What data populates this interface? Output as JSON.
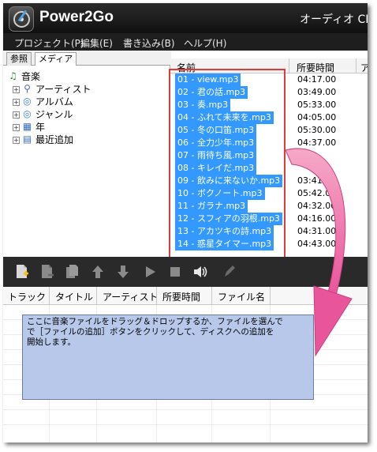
{
  "window": {
    "app_title": "Power2Go",
    "mode_label": "オーディオ CD"
  },
  "menu": [
    "プロジェクト(P)",
    "編集(E)",
    "書き込み(B)",
    "ヘルプ(H)"
  ],
  "tabs": [
    "参照",
    "メディア"
  ],
  "tree": [
    {
      "label": "音楽",
      "icon": "music-note-icon"
    },
    {
      "label": "アーティスト",
      "icon": "person-icon"
    },
    {
      "label": "アルバム",
      "icon": "disc-icon"
    },
    {
      "label": "ジャンル",
      "icon": "disc-icon"
    },
    {
      "label": "年",
      "icon": "calendar-icon"
    },
    {
      "label": "最近追加",
      "icon": "calendar-icon"
    }
  ],
  "file_list": {
    "columns": [
      "名前",
      "所要時間",
      "ア"
    ],
    "rows": [
      {
        "name": "01 - view.mp3",
        "duration": "04:17.00"
      },
      {
        "name": "02 - 君の話.mp3",
        "duration": "03:49.00"
      },
      {
        "name": "03 - 奏.mp3",
        "duration": "05:33.00"
      },
      {
        "name": "04 - ふれて未来を.mp3",
        "duration": "04:05.00"
      },
      {
        "name": "05 - 冬の口笛.mp3",
        "duration": "05:30.00"
      },
      {
        "name": "06 - 全力少年.mp3",
        "duration": "04:37.00"
      },
      {
        "name": "07 - 雨待ち風.mp3",
        "duration": ""
      },
      {
        "name": "08 - キレイだ.mp3",
        "duration": ""
      },
      {
        "name": "09 - 飲みに来ないか.mp3",
        "duration": "03:41.00"
      },
      {
        "name": "10 - ボクノート.mp3",
        "duration": "05:42.00"
      },
      {
        "name": "11 - ガラナ.mp3",
        "duration": "04:32.00"
      },
      {
        "name": "12 - スフィアの羽根.mp3",
        "duration": "04:16.00"
      },
      {
        "name": "13 - アカツキの詩.mp3",
        "duration": "04:31.00"
      },
      {
        "name": "14 - 惑星タイマー.mp3",
        "duration": "04:43.00"
      }
    ]
  },
  "toolbar_icons": [
    "add-file-icon",
    "remove-file-icon",
    "copy-icon",
    "move-up-icon",
    "move-down-icon",
    "play-icon",
    "stop-icon",
    "volume-icon",
    "edit-icon"
  ],
  "track_table": {
    "columns": [
      "トラック",
      "タイトル",
      "アーティスト",
      "所要時間",
      "ファイル名"
    ]
  },
  "hint": {
    "line1": "ここに音楽ファイルをドラッグ＆ドロップするか、ファイルを選んで",
    "line2": "で［ファイルの追加］ボタンをクリックして、ディスクへの追加を",
    "line3": "開始します。"
  },
  "colors": {
    "selection": "#3399ff",
    "highlight_box": "#e23b3b",
    "arrow": "#e9559a",
    "hint_background": "#b7c8ea"
  }
}
